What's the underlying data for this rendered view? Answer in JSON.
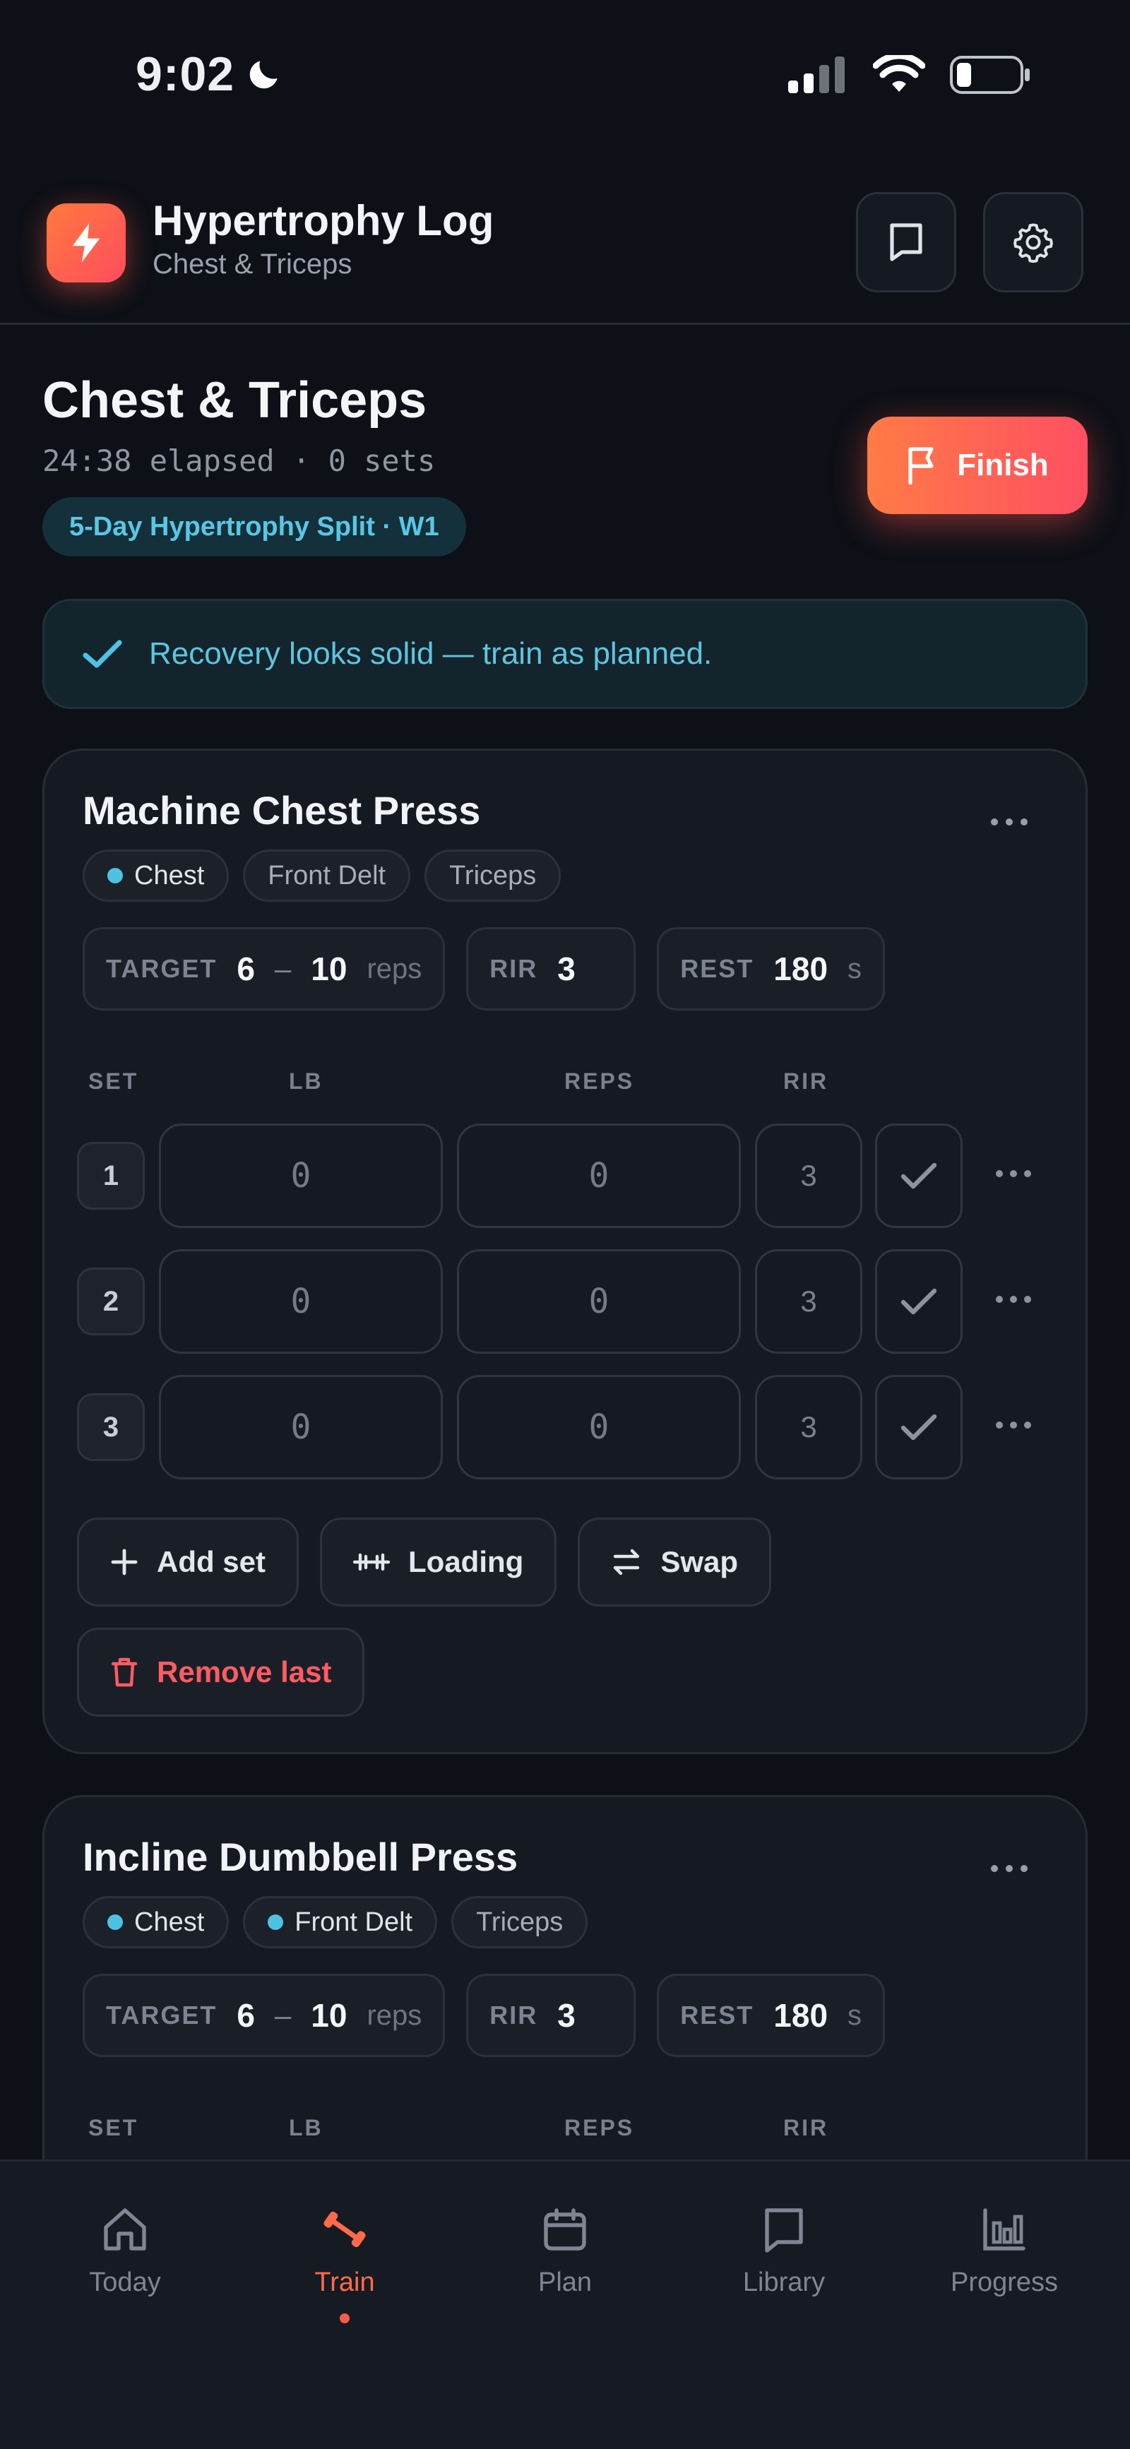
{
  "status_bar": {
    "time": "9:02"
  },
  "header": {
    "title": "Hypertrophy Log",
    "subtitle": "Chest & Triceps",
    "icons": [
      "bolt-icon",
      "notes-icon",
      "gear-icon"
    ]
  },
  "workout": {
    "title": "Chest & Triceps",
    "meta": "24:38 elapsed · 0 sets",
    "program": "5-Day Hypertrophy Split · W1",
    "finish_label": "Finish"
  },
  "banner": {
    "text": "Recovery looks solid — train as planned."
  },
  "colors": {
    "accent": "#ff6a4a",
    "cyan": "#4ec2e3",
    "danger": "#ff5b63",
    "background": "#0d1016"
  },
  "exercises": [
    {
      "name": "Machine Chest Press",
      "tags": [
        {
          "label": "Chest",
          "primary": true
        },
        {
          "label": "Front Delt",
          "primary": false
        },
        {
          "label": "Triceps",
          "primary": false
        }
      ],
      "target": {
        "label": "TARGET",
        "min": "6",
        "dash": "–",
        "max": "10",
        "unit": "reps"
      },
      "rir": {
        "label": "RIR",
        "value": "3"
      },
      "rest": {
        "label": "REST",
        "value": "180",
        "unit": "s"
      },
      "columns": {
        "set": "SET",
        "lb": "LB",
        "reps": "REPS",
        "rir": "RIR"
      },
      "sets": [
        {
          "num": "1",
          "lb": "0",
          "reps": "0",
          "rir": "3"
        },
        {
          "num": "2",
          "lb": "0",
          "reps": "0",
          "rir": "3"
        },
        {
          "num": "3",
          "lb": "0",
          "reps": "0",
          "rir": "3"
        }
      ],
      "actions": {
        "add_set": "Add set",
        "loading": "Loading",
        "swap": "Swap",
        "remove_last": "Remove last"
      }
    },
    {
      "name": "Incline Dumbbell Press",
      "tags": [
        {
          "label": "Chest",
          "primary": true
        },
        {
          "label": "Front Delt",
          "primary": true
        },
        {
          "label": "Triceps",
          "primary": false
        }
      ],
      "target": {
        "label": "TARGET",
        "min": "6",
        "dash": "–",
        "max": "10",
        "unit": "reps"
      },
      "rir": {
        "label": "RIR",
        "value": "3"
      },
      "rest": {
        "label": "REST",
        "value": "180",
        "unit": "s"
      },
      "columns": {
        "set": "SET",
        "lb": "LB",
        "reps": "REPS",
        "rir": "RIR"
      }
    }
  ],
  "nav": {
    "active": "Train",
    "items": [
      {
        "label": "Today",
        "icon": "home-icon"
      },
      {
        "label": "Train",
        "icon": "dumbbell-icon"
      },
      {
        "label": "Plan",
        "icon": "calendar-icon"
      },
      {
        "label": "Library",
        "icon": "book-icon"
      },
      {
        "label": "Progress",
        "icon": "bar-chart-icon"
      }
    ]
  }
}
